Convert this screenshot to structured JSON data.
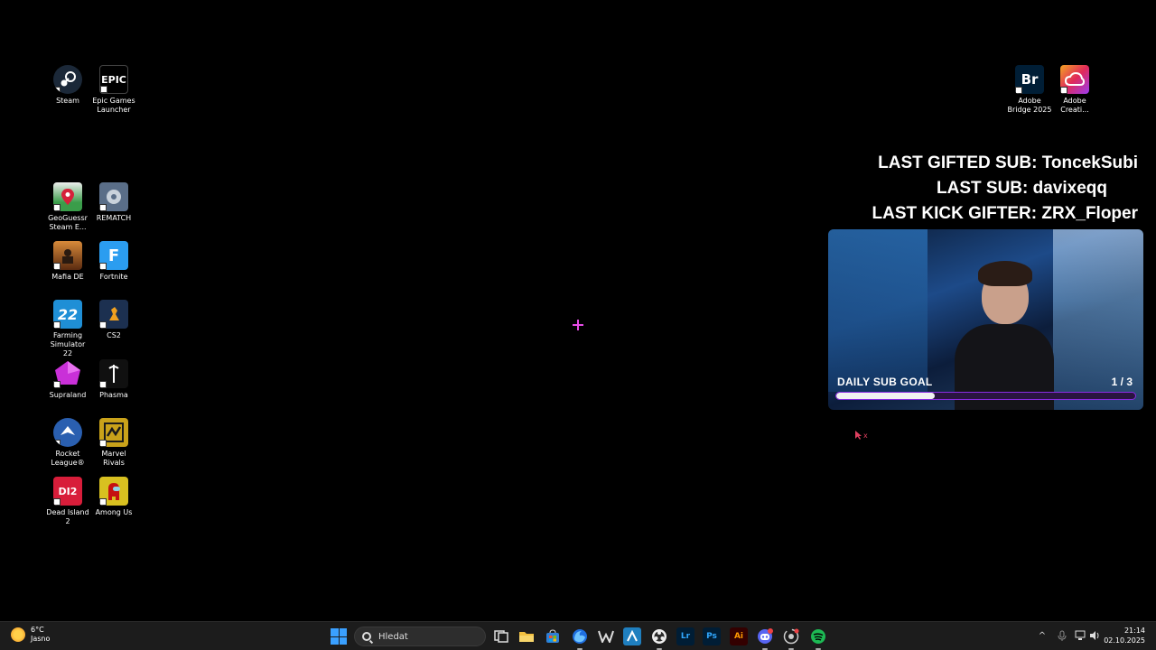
{
  "desktop": {
    "icons": [
      {
        "label": "Steam",
        "icon": "steam-icon",
        "color": "#1b2838"
      },
      {
        "label": "Epic Games Launcher",
        "icon": "epic-games-icon",
        "tile_text": "EPIC",
        "color": "#000000"
      },
      {
        "label": "GeoGuessr Steam E...",
        "icon": "geoguessr-icon",
        "color": "#3a9d4a"
      },
      {
        "label": "REMATCH",
        "icon": "rematch-icon",
        "color": "#5a6e88"
      },
      {
        "label": "Mafia DE",
        "icon": "mafia-icon",
        "color": "#8a4a1c"
      },
      {
        "label": "Fortnite",
        "icon": "fortnite-icon",
        "tile_text": "F",
        "color": "#2b9df0"
      },
      {
        "label": "Farming Simulator 22",
        "icon": "farming-simulator-icon",
        "tile_text": "22",
        "color": "#1f8fd6"
      },
      {
        "label": "CS2",
        "icon": "cs2-icon",
        "color": "#1c3050"
      },
      {
        "label": "Supraland",
        "icon": "supraland-icon",
        "color": "#c930d8"
      },
      {
        "label": "Phasma",
        "icon": "phasma-icon",
        "color": "#101010"
      },
      {
        "label": "Rocket League®",
        "icon": "rocket-league-icon",
        "color": "#2a5fb0"
      },
      {
        "label": "Marvel Rivals",
        "icon": "marvel-rivals-icon",
        "color": "#c9a21a"
      },
      {
        "label": "Dead Island 2",
        "icon": "dead-island-icon",
        "tile_text": "DI2",
        "color": "#d81d3a"
      },
      {
        "label": "Among Us",
        "icon": "among-us-icon",
        "color": "#d8c020"
      },
      {
        "label": "Adobe Bridge 2025",
        "icon": "adobe-bridge-icon",
        "tile_text": "Br",
        "color": "#001e36"
      },
      {
        "label": "Adobe Creati...",
        "icon": "adobe-creative-cloud-icon",
        "color": "#e0295a"
      }
    ]
  },
  "overlay": {
    "last_gifted_sub": "LAST GIFTED SUB: ToncekSubi",
    "last_sub": "LAST SUB: davixeqq",
    "last_kick_gifter": "LAST KICK GIFTER: ZRX_Floper",
    "daily_goal_label": "DAILY SUB GOAL",
    "daily_goal_count": "1 / 3",
    "daily_goal_progress": 0.33
  },
  "taskbar": {
    "weather_temp": "6°C",
    "weather_desc": "Jasno",
    "search_placeholder": "Hledat",
    "apps": [
      {
        "name": "task-view-icon",
        "color": "#3b3b3b"
      },
      {
        "name": "file-explorer-icon",
        "color": "#f2c040"
      },
      {
        "name": "microsoft-store-icon",
        "color": "#2f7fd6"
      },
      {
        "name": "firefox-icon",
        "color": "#1f6fe0"
      },
      {
        "name": "wolf-icon",
        "color": "#2b2b2b"
      },
      {
        "name": "app-blue-icon",
        "color": "#1f7fbf"
      },
      {
        "name": "obs-icon",
        "color": "#2b2b2b"
      },
      {
        "name": "lightroom-icon",
        "tile_text": "Lr",
        "color": "#001d35"
      },
      {
        "name": "photoshop-icon",
        "tile_text": "Ps",
        "color": "#001d35"
      },
      {
        "name": "illustrator-icon",
        "tile_text": "Ai",
        "color": "#330000"
      },
      {
        "name": "discord-icon",
        "color": "#5865f2"
      },
      {
        "name": "chrome-icon",
        "color": "#555555"
      },
      {
        "name": "spotify-icon",
        "color": "#1db954"
      }
    ],
    "time": "21:14",
    "date": "02.10.2025"
  }
}
